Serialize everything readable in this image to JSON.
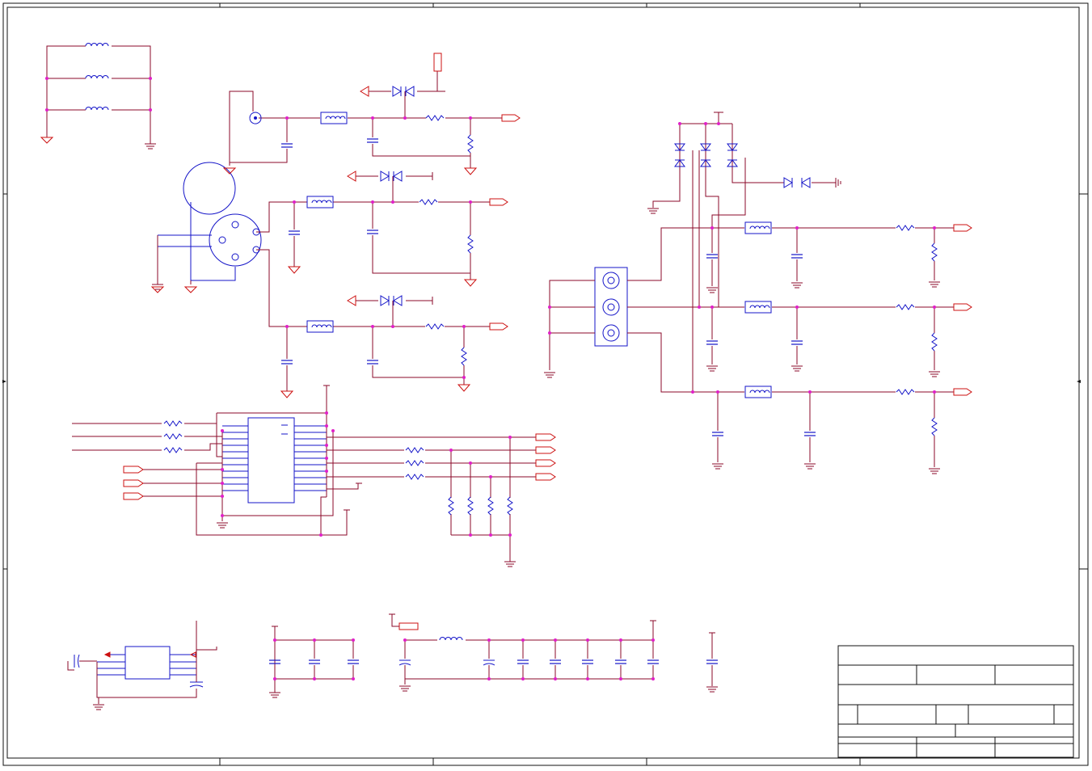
{
  "sheet": {
    "title": "",
    "zones": [
      "",
      "",
      "",
      ""
    ]
  },
  "title_block": {
    "company": "",
    "title": "",
    "size": "",
    "document_number": "",
    "revision": "",
    "date": "",
    "sheet": ""
  },
  "colors": {
    "background": "#ffffff",
    "wire": "#8b0a2a",
    "component": "#1414c8",
    "power": "#cc1010",
    "junction": "#e020c8",
    "frame": "#111111"
  },
  "icons": {
    "ground": "ground-icon",
    "offpage_connector": "offpage-connector-icon",
    "resistor": "resistor-icon",
    "capacitor": "capacitor-icon",
    "inductor": "inductor-icon",
    "diode": "diode-icon",
    "connector": "rca-connector-icon",
    "ic": "ic-icon"
  }
}
